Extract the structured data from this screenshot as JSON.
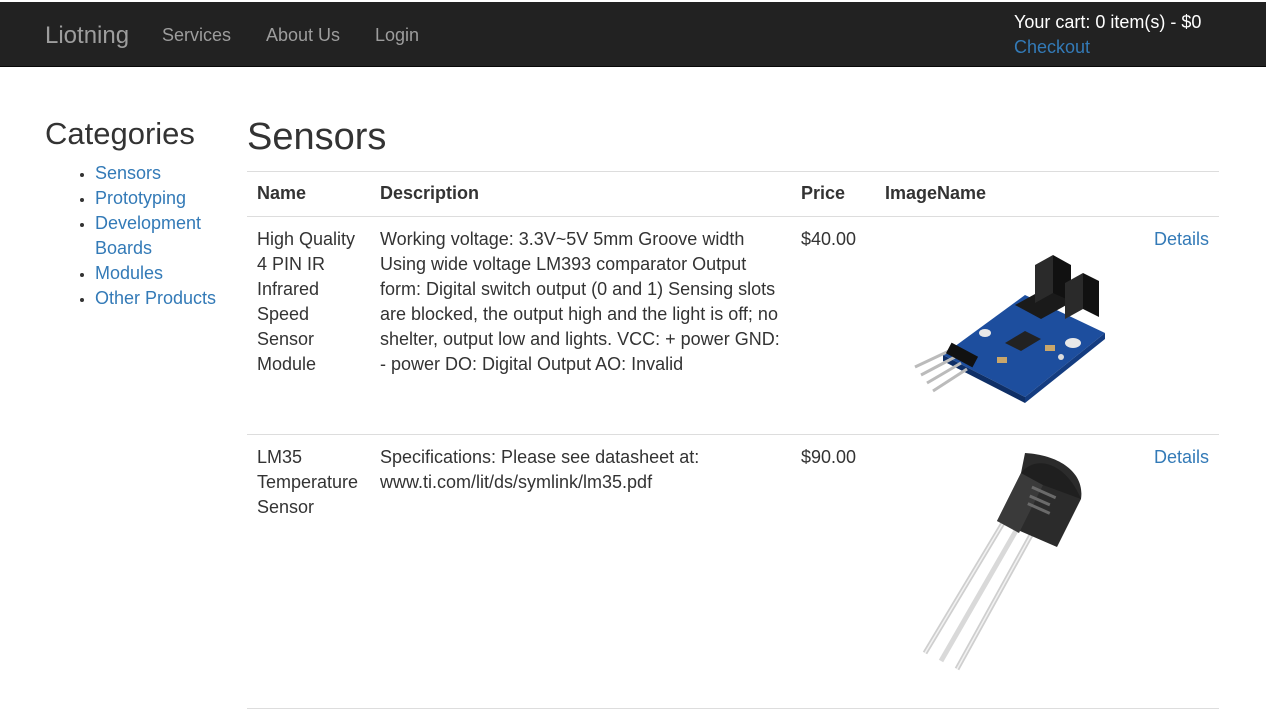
{
  "navbar": {
    "brand": "Liotning",
    "links": [
      "Services",
      "About Us",
      "Login"
    ],
    "cart_summary": "Your cart: 0 item(s) - $0",
    "checkout": "Checkout"
  },
  "sidebar": {
    "title": "Categories",
    "items": [
      "Sensors",
      "Prototyping",
      "Development Boards",
      "Modules",
      "Other Products"
    ]
  },
  "main": {
    "title": "Sensors",
    "columns": [
      "Name",
      "Description",
      "Price",
      "ImageName",
      ""
    ],
    "products": [
      {
        "name": "High Quality 4 PIN IR Infrared Speed Sensor Module",
        "description": "Working voltage: 3.3V~5V 5mm Groove width Using wide voltage LM393 comparator Output form: Digital switch output (0 and 1) Sensing slots are blocked, the output high and the light is off; no shelter, output low and lights. VCC: + power GND: - power DO: Digital Output AO: Invalid",
        "price": "$40.00",
        "details": "Details"
      },
      {
        "name": "LM35 Temperature Sensor",
        "description": "Specifications: Please see datasheet at: www.ti.com/lit/ds/symlink/lm35.pdf",
        "price": "$90.00",
        "details": "Details"
      }
    ]
  }
}
